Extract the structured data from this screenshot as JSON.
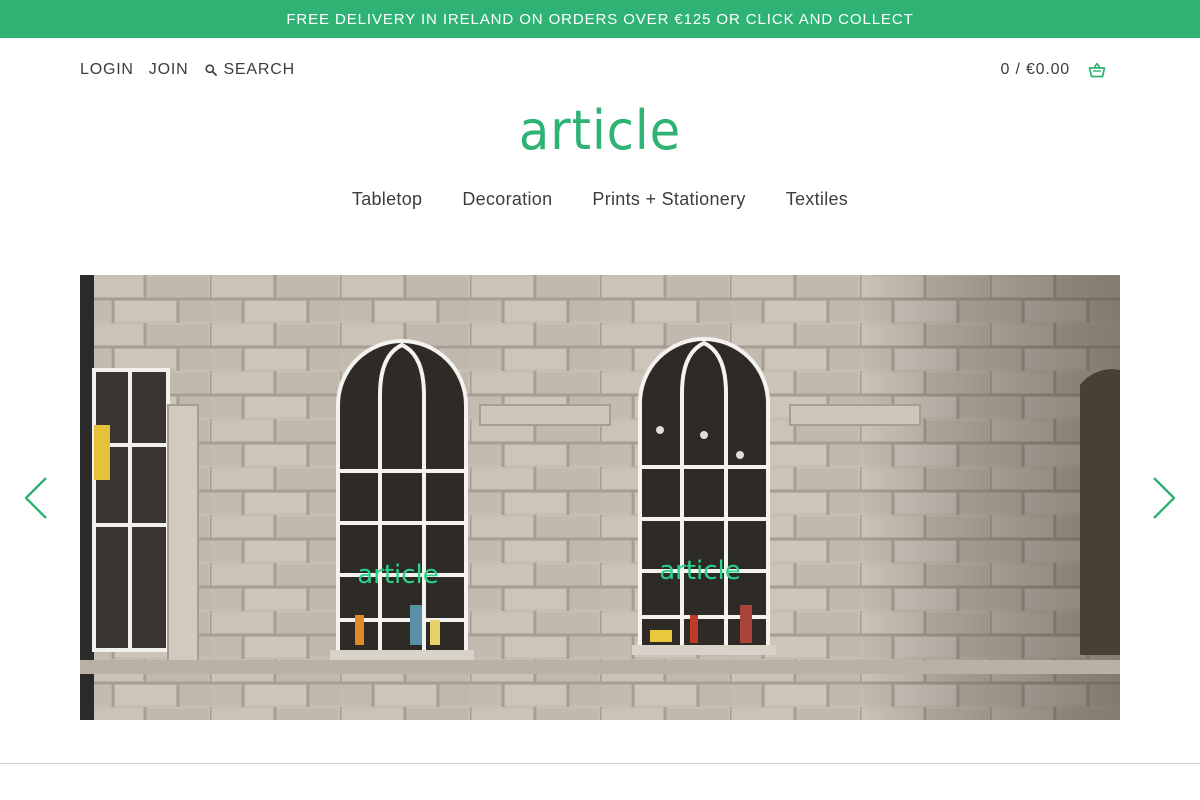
{
  "announcement": "FREE DELIVERY IN IRELAND ON ORDERS OVER €125 OR CLICK AND COLLECT",
  "utility": {
    "login": "LOGIN",
    "join": "JOIN",
    "search": "SEARCH",
    "cart": "0 / €0.00"
  },
  "logo": "article",
  "nav": [
    "Tabletop",
    "Decoration",
    "Prints + Stationery",
    "Textiles"
  ],
  "hero": {
    "window_sign_left": "article",
    "window_sign_right": "article"
  },
  "colors": {
    "brand_green": "#2fb374",
    "text": "#3d3d3d",
    "stone": "#c4bcb0"
  },
  "icons": {
    "search": "search-icon",
    "cart": "basket-icon",
    "prev": "chevron-left-icon",
    "next": "chevron-right-icon"
  }
}
